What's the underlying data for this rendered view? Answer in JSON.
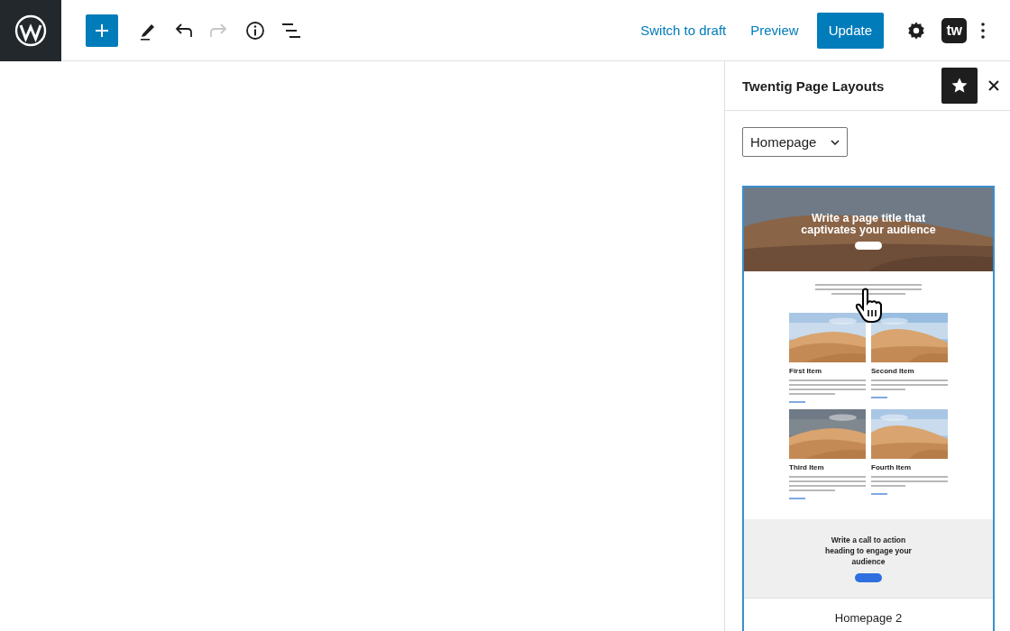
{
  "toolbar": {
    "tools": [
      {
        "kind": "add",
        "disabled": false
      },
      {
        "kind": "edit",
        "disabled": false
      },
      {
        "kind": "undo",
        "disabled": false
      },
      {
        "kind": "redo",
        "disabled": true
      },
      {
        "kind": "info",
        "disabled": false
      },
      {
        "kind": "outline",
        "disabled": false
      }
    ],
    "switch_to_draft": "Switch to draft",
    "preview": "Preview",
    "update": "Update",
    "plugin_badge": "tw"
  },
  "sidebar": {
    "title": "Twentig Page Layouts",
    "pinned": true,
    "category": {
      "value": "Homepage"
    },
    "layouts": [
      {
        "name": "Homepage 2",
        "selected": true,
        "preview": {
          "hero_title": "Write a page title that captivates your audience",
          "items": [
            {
              "title": "First Item"
            },
            {
              "title": "Second Item"
            },
            {
              "title": "Third Item"
            },
            {
              "title": "Fourth Item"
            }
          ],
          "cta_title": "Write a call to action heading to engage your audience"
        }
      }
    ]
  }
}
